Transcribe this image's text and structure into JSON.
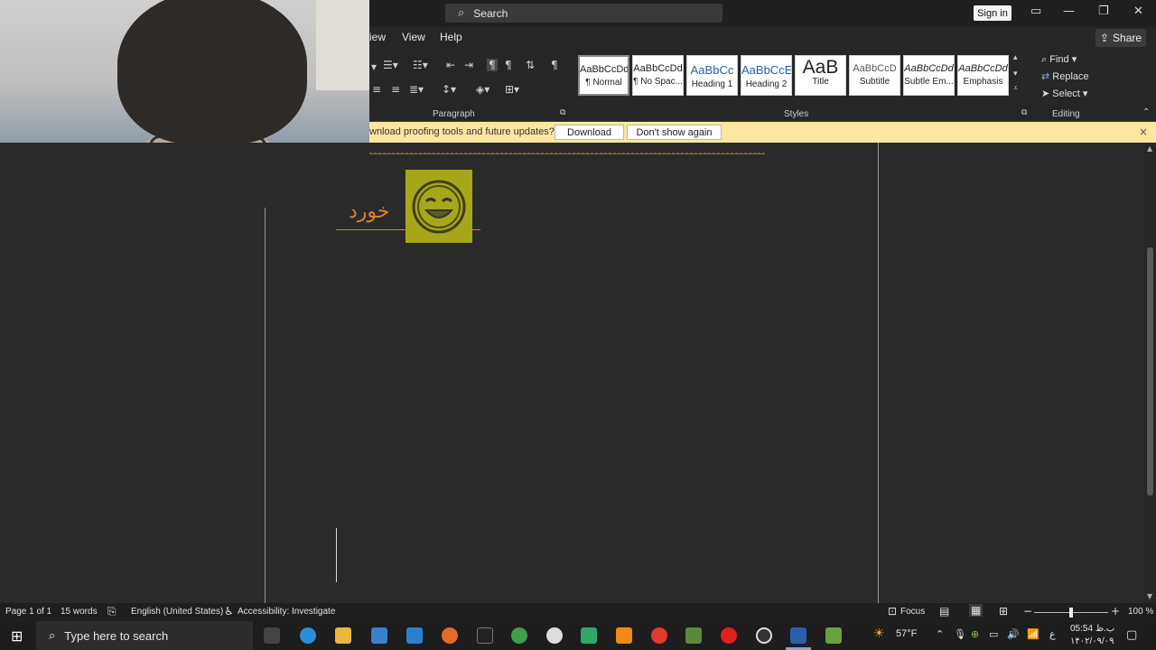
{
  "titlebar": {
    "search_placeholder": "Search",
    "sign_in": "Sign in",
    "minimize": "—",
    "restore": "❐",
    "close": "✕",
    "mode_icon": "▭"
  },
  "tabs": [
    {
      "label": "iew"
    },
    {
      "label": "View"
    },
    {
      "label": "Help"
    }
  ],
  "share_label": "Share",
  "groups": {
    "paragraph": "Paragraph",
    "styles": "Styles",
    "editing": "Editing"
  },
  "styles": [
    {
      "preview": "AaBbCcDd",
      "name": "¶ Normal"
    },
    {
      "preview": "AaBbCcDd",
      "name": "¶ No Spac..."
    },
    {
      "preview": "AaBbCc",
      "name": "Heading 1"
    },
    {
      "preview": "AaBbCcE",
      "name": "Heading 2"
    },
    {
      "preview": "AaB",
      "name": "Title"
    },
    {
      "preview": "AaBbCcD",
      "name": "Subtitle"
    },
    {
      "preview": "AaBbCcDd",
      "name": "Subtle Em..."
    },
    {
      "preview": "AaBbCcDd",
      "name": "Emphasis"
    }
  ],
  "editing": {
    "find": "Find",
    "replace": "Replace",
    "select": "Select"
  },
  "message_bar": {
    "text": "wnload proofing tools and future updates?",
    "download": "Download",
    "dont_show": "Don't show again",
    "close": "×"
  },
  "document": {
    "arabic_word": "خورد"
  },
  "status": {
    "page": "Page 1 of 1",
    "words": "15 words",
    "language": "English (United States)",
    "accessibility": "Accessibility: Investigate",
    "focus": "Focus",
    "zoom": "100 %"
  },
  "taskbar": {
    "search_placeholder": "Type here to search",
    "weather": "57°F",
    "time": "05:54 ب.ظ",
    "date": "۱۴۰۲/۰۹/۰۹"
  },
  "colors": {
    "accent_yellow": "#fbe7a0",
    "smiley_bg": "#a6a61a",
    "text_orange": "#d2862c"
  }
}
